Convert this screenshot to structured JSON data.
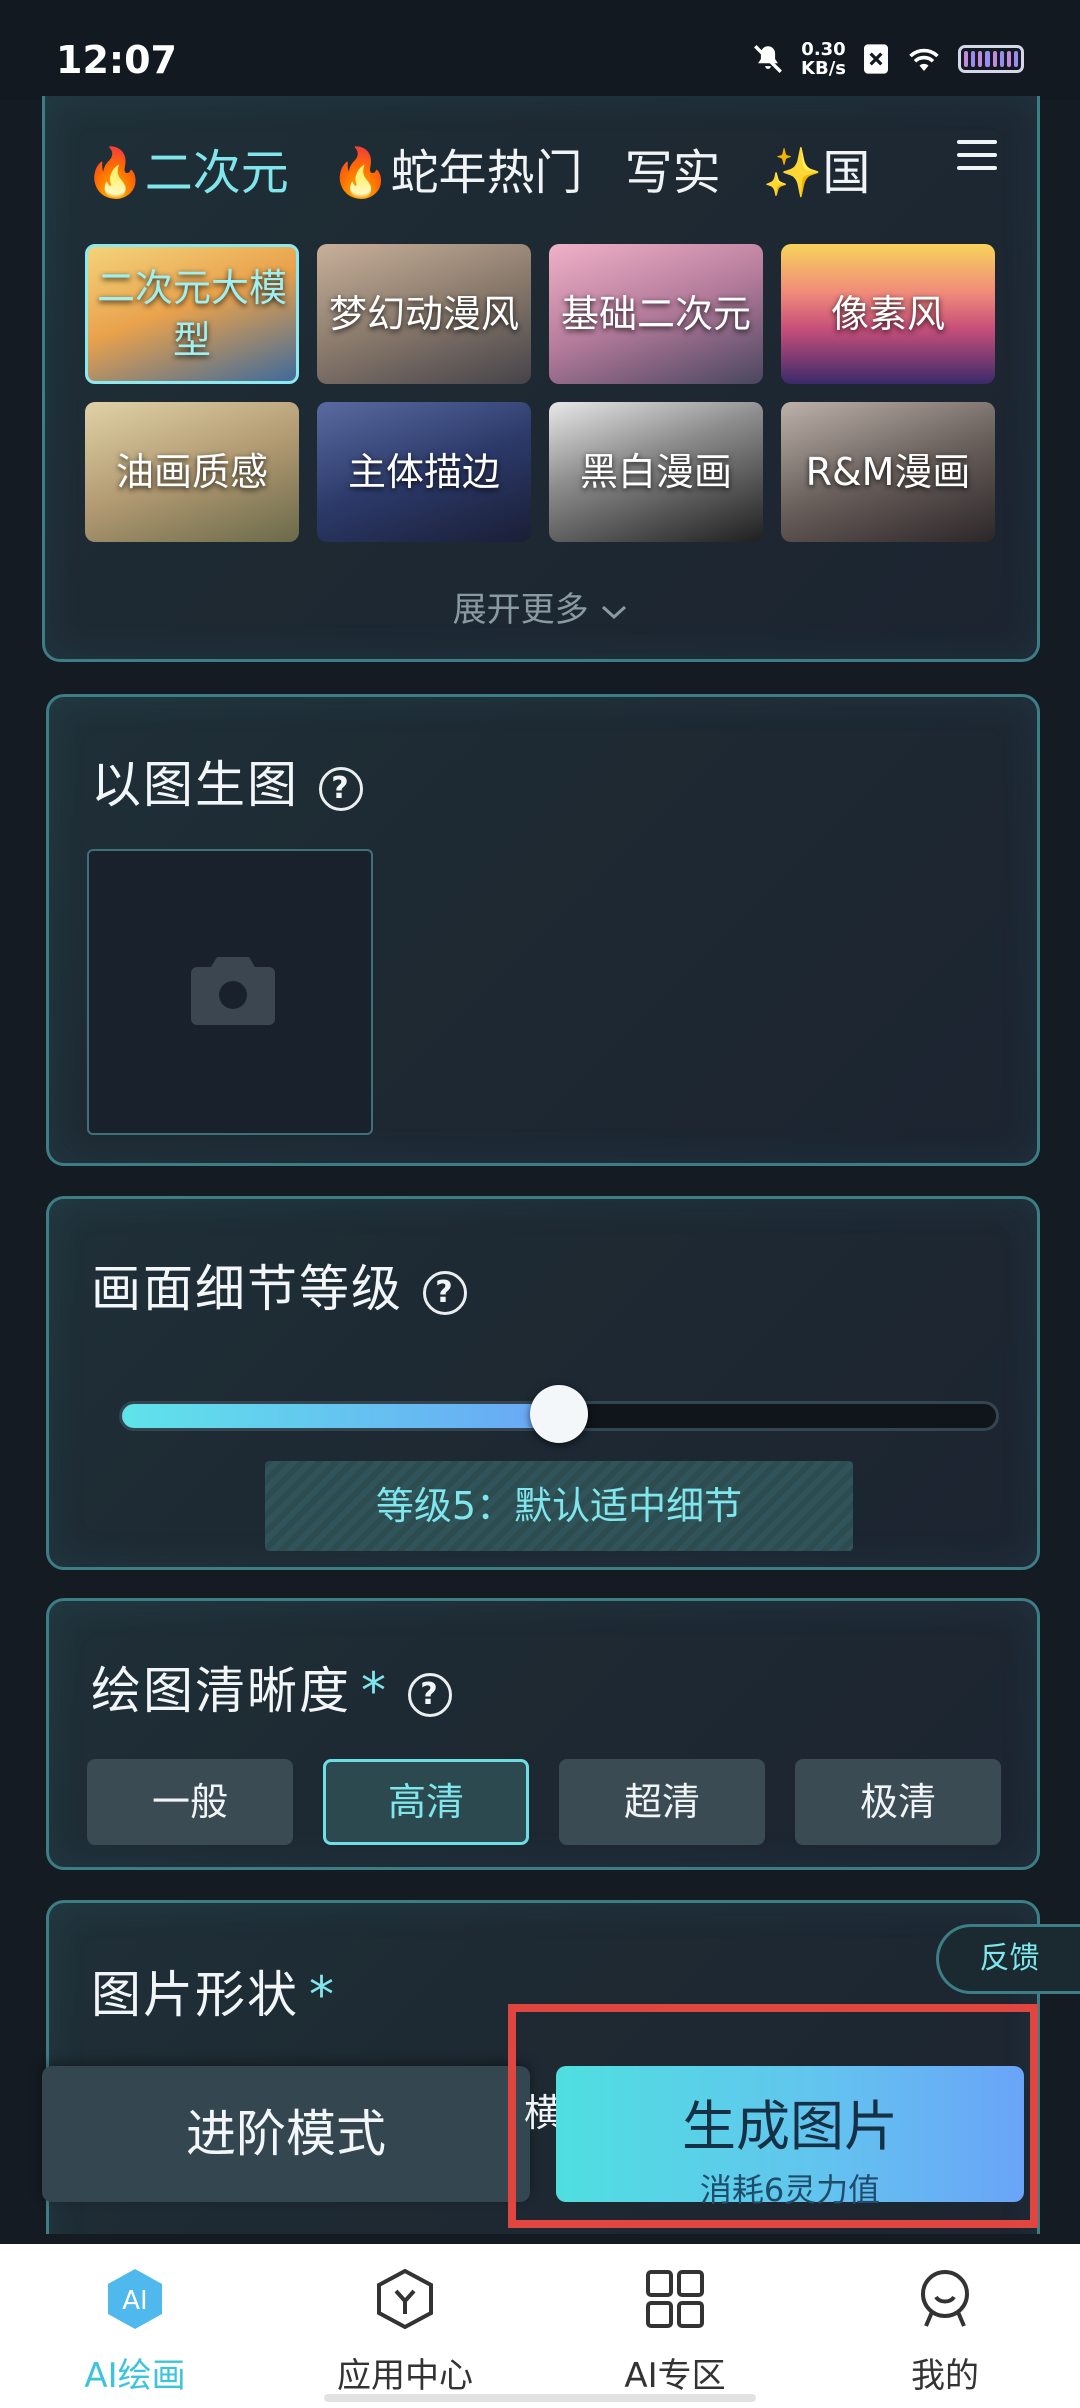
{
  "status_bar": {
    "time": "12:07",
    "net_speed_value": "0.30",
    "net_speed_unit": "KB/s"
  },
  "style_section": {
    "tabs": [
      {
        "label": "🔥二次元",
        "active": true
      },
      {
        "label": "🔥蛇年热门",
        "active": false
      },
      {
        "label": "写实",
        "active": false
      },
      {
        "label": "✨国",
        "active": false
      }
    ],
    "styles": [
      {
        "label": "二次元大模型",
        "selected": true
      },
      {
        "label": "梦幻动漫风",
        "selected": false
      },
      {
        "label": "基础二次元",
        "selected": false
      },
      {
        "label": "像素风",
        "selected": false
      },
      {
        "label": "油画质感",
        "selected": false
      },
      {
        "label": "主体描边",
        "selected": false
      },
      {
        "label": "黑白漫画",
        "selected": false
      },
      {
        "label": "R&M漫画",
        "selected": false
      }
    ],
    "expand_label": "展开更多"
  },
  "img2img": {
    "title": "以图生图",
    "help": "?"
  },
  "detail": {
    "title": "画面细节等级",
    "help": "?",
    "level": 5,
    "level_max": 10,
    "level_label": "等级5：默认适中细节"
  },
  "resolution": {
    "title": "绘图清晰度",
    "required_mark": "*",
    "help": "?",
    "options": [
      {
        "label": "一般",
        "active": false
      },
      {
        "label": "高清",
        "active": true
      },
      {
        "label": "超清",
        "active": false
      },
      {
        "label": "极清",
        "active": false
      }
    ]
  },
  "shape": {
    "title": "图片形状",
    "required_mark": "*",
    "peek_text": "横"
  },
  "feedback_label": "反馈",
  "actions": {
    "advanced_label": "进阶模式",
    "generate_label": "生成图片",
    "generate_cost": "消耗6灵力值"
  },
  "nav": [
    {
      "label": "AI绘画",
      "icon": "ai-paint-icon",
      "active": true
    },
    {
      "label": "应用中心",
      "icon": "app-center-icon",
      "active": false
    },
    {
      "label": "AI专区",
      "icon": "grid-icon",
      "active": false
    },
    {
      "label": "我的",
      "icon": "profile-icon",
      "active": false
    }
  ],
  "colors": {
    "accent": "#7fe6ec",
    "highlight": "#e0463f",
    "background": "#141b22"
  }
}
